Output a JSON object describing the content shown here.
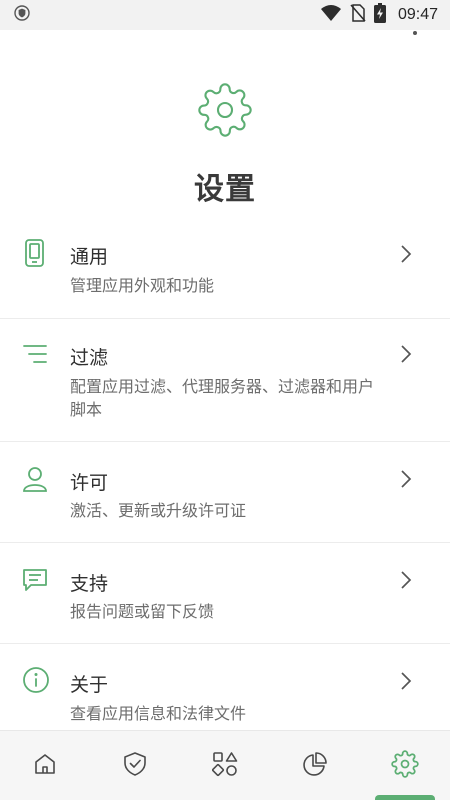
{
  "status_bar": {
    "time": "09:47",
    "icons": [
      "vpn-shield-icon",
      "wifi-icon",
      "no-sim-icon",
      "battery-charging-icon"
    ]
  },
  "header": {
    "icon": "gear-icon",
    "title": "设置"
  },
  "settings": [
    {
      "icon": "phone-icon",
      "title": "通用",
      "description": "管理应用外观和功能"
    },
    {
      "icon": "filter-lines-icon",
      "title": "过滤",
      "description": "配置应用过滤、代理服务器、过滤器和用户脚本"
    },
    {
      "icon": "user-icon",
      "title": "许可",
      "description": "激活、更新或升级许可证"
    },
    {
      "icon": "chat-icon",
      "title": "支持",
      "description": "报告问题或留下反馈"
    },
    {
      "icon": "info-icon",
      "title": "关于",
      "description": "查看应用信息和法律文件"
    }
  ],
  "bottom_nav": {
    "items": [
      "home-icon",
      "shield-check-icon",
      "apps-icon",
      "stats-pie-icon",
      "gear-icon"
    ],
    "active_index": 4
  },
  "colors": {
    "accent": "#5cae73",
    "text": "#2f2f2f",
    "secondary_text": "#6d6d6d",
    "status_bar_bg": "#f2f2f2",
    "nav_bg": "#f6f6f6"
  }
}
